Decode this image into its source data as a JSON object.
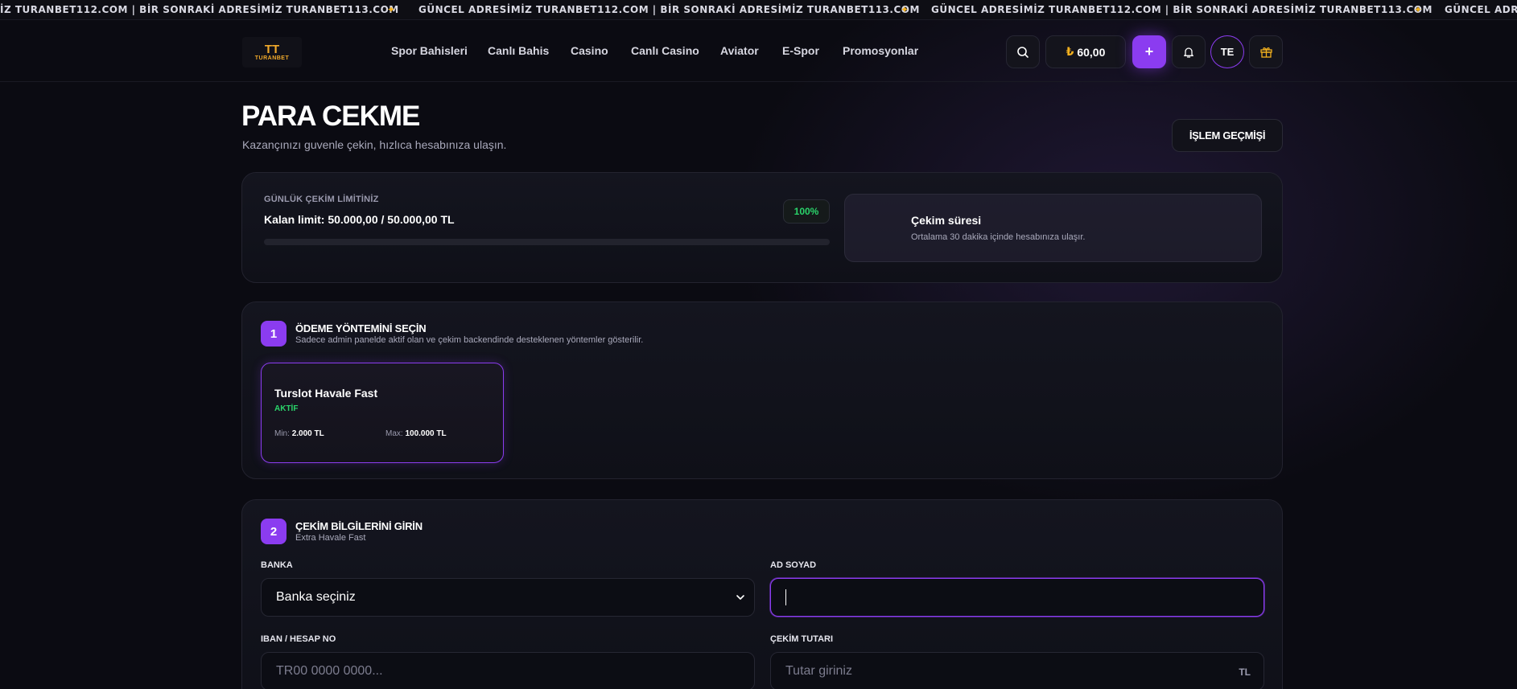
{
  "ticker": {
    "segment": "GÜNCEL ADRESİMİZ TURANBET112.COM | BİR SONRAKİ ADRESİMİZ TURANBET113.COM",
    "segment_cut": "İZ TURANBET112.COM | BİR SONRAKİ ADRESİMİZ TURANBET113.COM",
    "segment_end": "GÜNCEL ADRE",
    "separator": "✦"
  },
  "header": {
    "logo_text": "TURANBET",
    "nav": [
      "Spor Bahisleri",
      "Canlı Bahis",
      "Casino",
      "Canlı Casino",
      "Aviator",
      "E-Spor",
      "Promosyonlar"
    ],
    "balance_currency": "₺",
    "balance": "60,00",
    "deposit_label": "+",
    "avatar_initials": "TE"
  },
  "page": {
    "title": "PARA CEKME",
    "subtitle": "Kazançınızı guvenle çekin, hızlıca hesabınıza ulaşın.",
    "history_button": "İŞLEM GEÇMİŞİ"
  },
  "limit": {
    "label": "GÜNLÜK ÇEKİM LİMİTİNİZ",
    "value": "Kalan limit: 50.000,00 / 50.000,00 TL",
    "percent_label": "100%",
    "progress_fraction": 1.0,
    "time_title": "Çekim süresi",
    "time_sub": "Ortalama 30 dakika içinde hesabınıza ulaşır."
  },
  "step1": {
    "number": "1",
    "title": "ÖDEME YÖNTEMİNİ SEÇİN",
    "subtitle": "Sadece admin panelde aktif olan ve çekim backendinde desteklenen yöntemler gösterilir.",
    "method": {
      "name": "Turslot Havale Fast",
      "status": "AKTİF",
      "min_label": "Min:",
      "min_value": "2.000 TL",
      "max_label": "Max:",
      "max_value": "100.000 TL"
    }
  },
  "step2": {
    "number": "2",
    "title": "ÇEKİM BİLGİLERİNİ GİRİN",
    "subtitle": "Extra Havale Fast",
    "bank_label": "BANKA",
    "bank_value": "Banka seçiniz",
    "name_label": "AD SOYAD",
    "name_value": "",
    "iban_label": "IBAN / HESAP NO",
    "iban_placeholder": "TR00 0000 0000...",
    "amount_label": "ÇEKİM TUTARI",
    "amount_placeholder": "Tutar giriniz",
    "amount_suffix": "TL"
  },
  "colors": {
    "accent": "#8b3cf0",
    "success": "#2ad46a",
    "gold": "#f2b01e"
  }
}
